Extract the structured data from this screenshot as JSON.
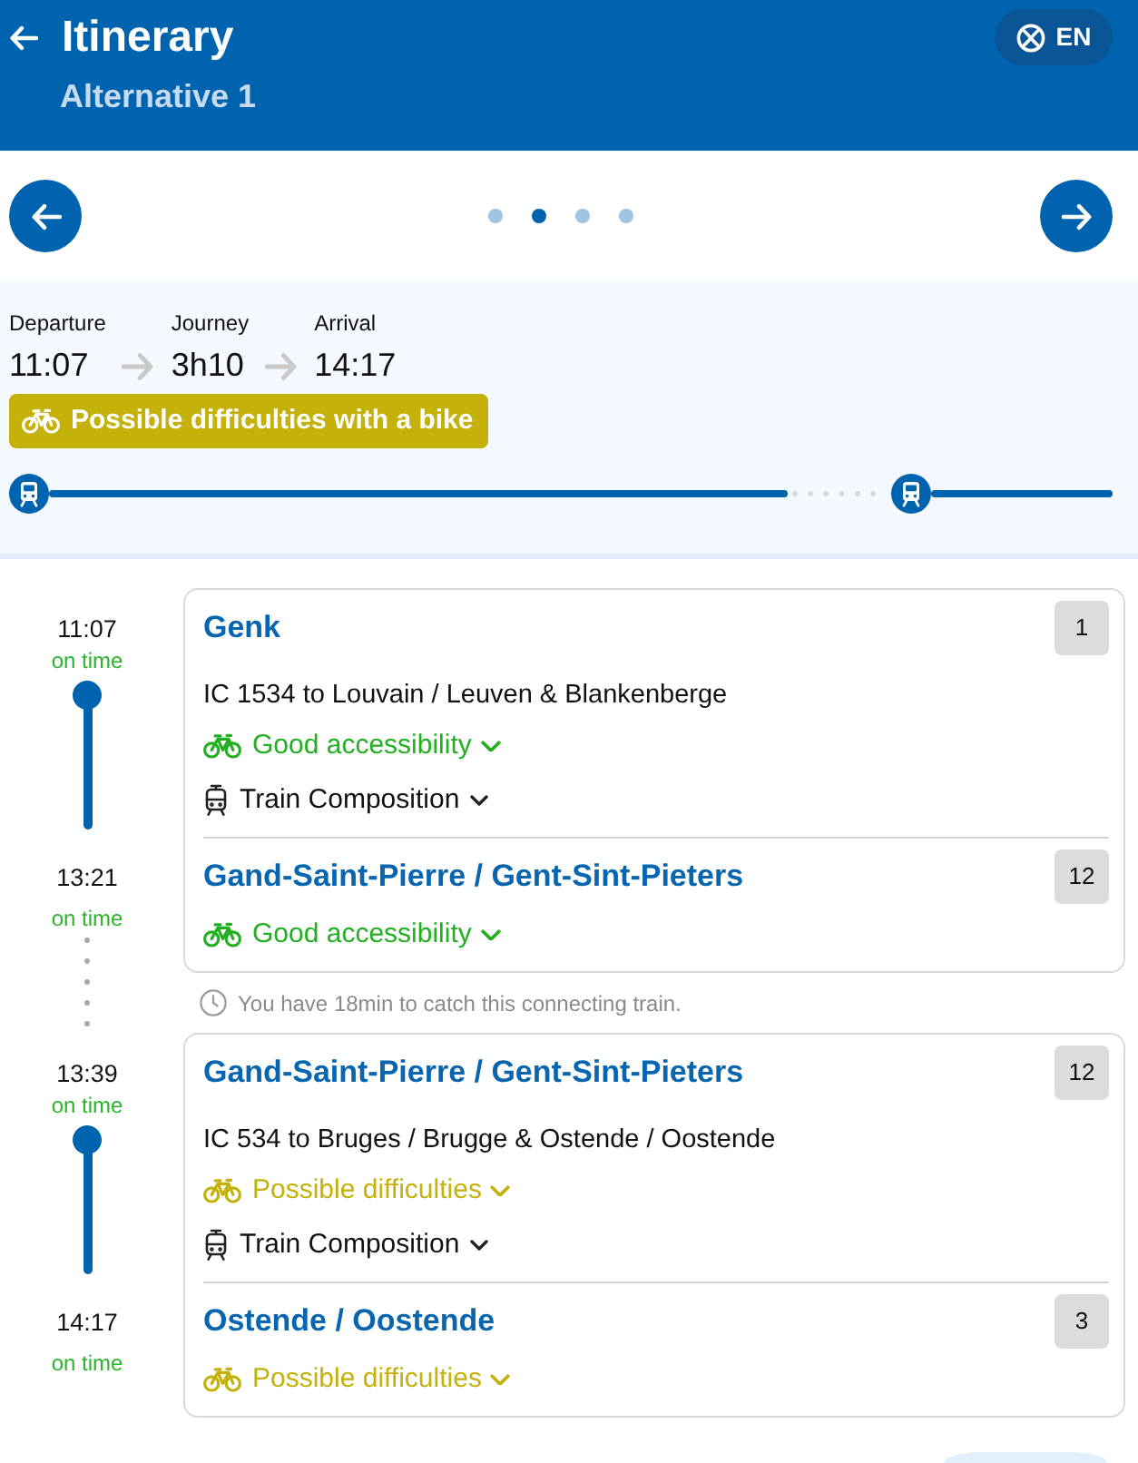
{
  "header": {
    "title": "Itinerary",
    "subtitle": "Alternative 1",
    "language": "EN"
  },
  "pager": [
    {
      "selected": false
    },
    {
      "selected": true
    },
    {
      "selected": false
    },
    {
      "selected": false
    }
  ],
  "summary": {
    "departure_label": "Departure",
    "departure": "11:07",
    "journey_label": "Journey",
    "journey": "3h10",
    "arrival_label": "Arrival",
    "arrival": "14:17",
    "bike_badge": "Possible difficulties with a bike"
  },
  "journey": [
    {
      "kind": "leg",
      "stops": [
        {
          "time": "11:07",
          "status": "on time",
          "station": "Genk",
          "platform": "1",
          "train": "IC 1534 to Louvain / Leuven & Blankenberge",
          "bike": {
            "kind": "good",
            "text": "Good accessibility"
          },
          "composition": "Train Composition"
        },
        {
          "time": "13:21",
          "status": "on time",
          "station": "Gand-Saint-Pierre / Gent-Sint-Pieters",
          "platform": "12",
          "bike": {
            "kind": "good",
            "text": "Good accessibility"
          }
        }
      ]
    },
    {
      "kind": "transfer",
      "note": "You have 18min to catch this connecting train."
    },
    {
      "kind": "leg",
      "stops": [
        {
          "time": "13:39",
          "status": "on time",
          "station": "Gand-Saint-Pierre / Gent-Sint-Pieters",
          "platform": "12",
          "train": "IC 534 to Bruges / Brugge & Ostende / Oostende",
          "bike": {
            "kind": "limited",
            "text": "Possible difficulties"
          },
          "composition": "Train Composition"
        },
        {
          "time": "14:17",
          "status": "on time",
          "station": "Ostende / Oostende",
          "platform": "3",
          "bike": {
            "kind": "limited",
            "text": "Possible difficulties"
          }
        }
      ]
    }
  ]
}
